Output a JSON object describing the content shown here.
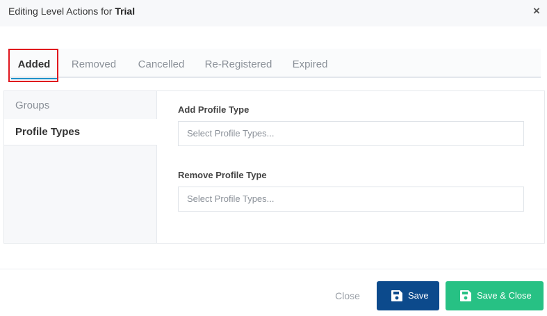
{
  "header": {
    "title_prefix": "Editing Level Actions for ",
    "entity": "Trial",
    "close_glyph": "×"
  },
  "tabs": [
    {
      "label": "Added",
      "active": true
    },
    {
      "label": "Removed",
      "active": false
    },
    {
      "label": "Cancelled",
      "active": false
    },
    {
      "label": "Re-Registered",
      "active": false
    },
    {
      "label": "Expired",
      "active": false
    }
  ],
  "sidebar": {
    "items": [
      {
        "label": "Groups",
        "active": false
      },
      {
        "label": "Profile Types",
        "active": true
      }
    ]
  },
  "form": {
    "add": {
      "label": "Add Profile Type",
      "placeholder": "Select Profile Types..."
    },
    "remove": {
      "label": "Remove Profile Type",
      "placeholder": "Select Profile Types..."
    }
  },
  "footer": {
    "close_label": "Close",
    "save_label": "Save",
    "save_close_label": "Save & Close",
    "save_icon": "floppy-disk-icon"
  },
  "colors": {
    "primary": "#0c4a8c",
    "success": "#27c184",
    "tab_underline": "#1e90c8",
    "highlight": "#e0161e"
  }
}
